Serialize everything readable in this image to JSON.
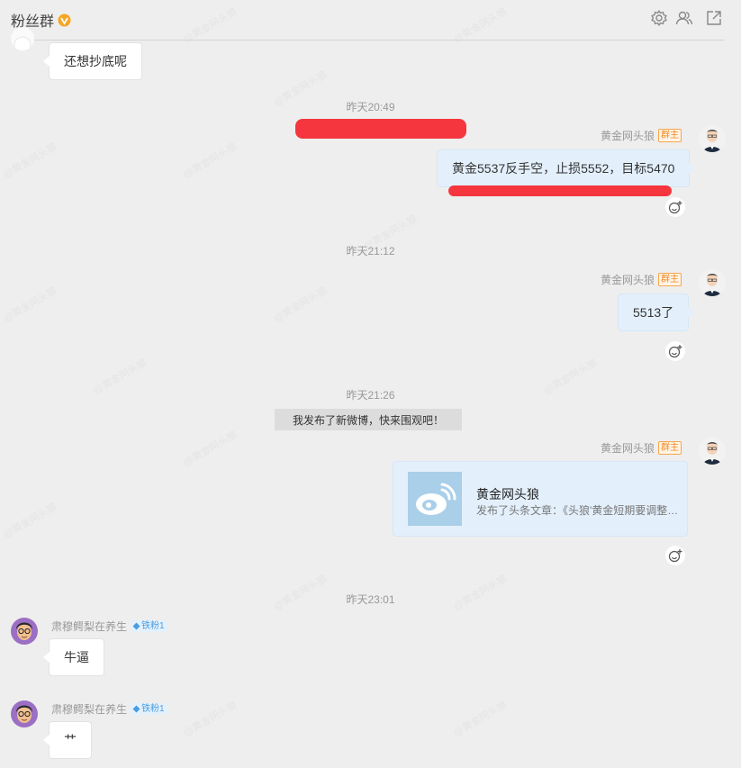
{
  "header": {
    "title": "粉丝群",
    "icons": [
      "gear-icon",
      "members-icon",
      "popout-icon"
    ]
  },
  "messages": {
    "m0": {
      "text": "还想抄底呢"
    },
    "t1": {
      "time": "昨天20:49"
    },
    "m1": {
      "sender": "黄金网头狼",
      "badge": "群主",
      "text": "黄金5537反手空，止损5552，目标5470"
    },
    "t2": {
      "time": "昨天21:12"
    },
    "m2": {
      "sender": "黄金网头狼",
      "badge": "群主",
      "text": "5513了"
    },
    "t3": {
      "time": "昨天21:26"
    },
    "sys": {
      "text": "我发布了新微博，快来围观吧！"
    },
    "m3": {
      "sender": "黄金网头狼",
      "badge": "群主",
      "card_title": "黄金网头狼",
      "card_subtitle": "发布了头条文章：《头狼'黄金短期要调整了》"
    },
    "t4": {
      "time": "昨天23:01"
    },
    "m4": {
      "sender": "肃穆鳄梨在养生",
      "badge": "铁粉1",
      "text": "牛逼"
    },
    "m5": {
      "sender": "肃穆鳄梨在养生",
      "badge": "铁粉1",
      "text": "艹"
    }
  },
  "colors": {
    "accent": "#f08a24",
    "redaction": "#f5363f",
    "bubble_self": "#e3f0fc"
  }
}
